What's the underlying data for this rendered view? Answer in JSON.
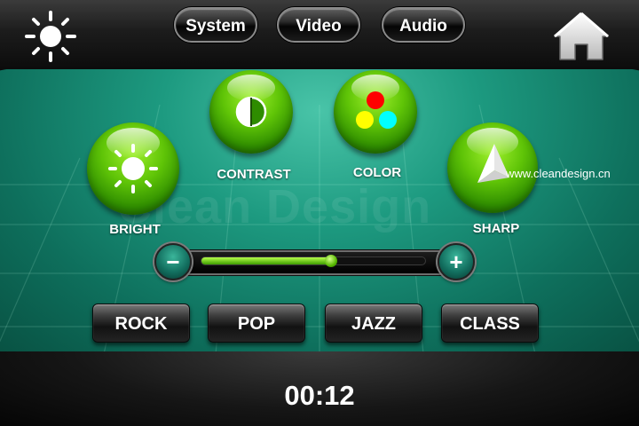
{
  "top_tabs": [
    {
      "label": "System"
    },
    {
      "label": "Video"
    },
    {
      "label": "Audio"
    }
  ],
  "top_icons": {
    "left": "sun-icon",
    "right": "home-icon"
  },
  "controls": [
    {
      "label": "BRIGHT",
      "icon": "sun-icon"
    },
    {
      "label": "CONTRAST",
      "icon": "contrast-half-circle-icon"
    },
    {
      "label": "COLOR",
      "icon": "rgb-dots-icon",
      "dot_colors": [
        "#ff0000",
        "#ffff00",
        "#00ffff"
      ]
    },
    {
      "label": "SHARP",
      "icon": "prism-icon"
    }
  ],
  "slider": {
    "value": 0.58,
    "minus_label": "−",
    "plus_label": "+"
  },
  "presets": [
    {
      "label": "ROCK"
    },
    {
      "label": "POP"
    },
    {
      "label": "JAZZ"
    },
    {
      "label": "CLASS"
    }
  ],
  "watermark": "Clean Design",
  "website": "www.cleandesign.cn",
  "time": "00:12",
  "colors": {
    "accent_green": "#5fc407",
    "stage_teal": "#1d9a80"
  }
}
